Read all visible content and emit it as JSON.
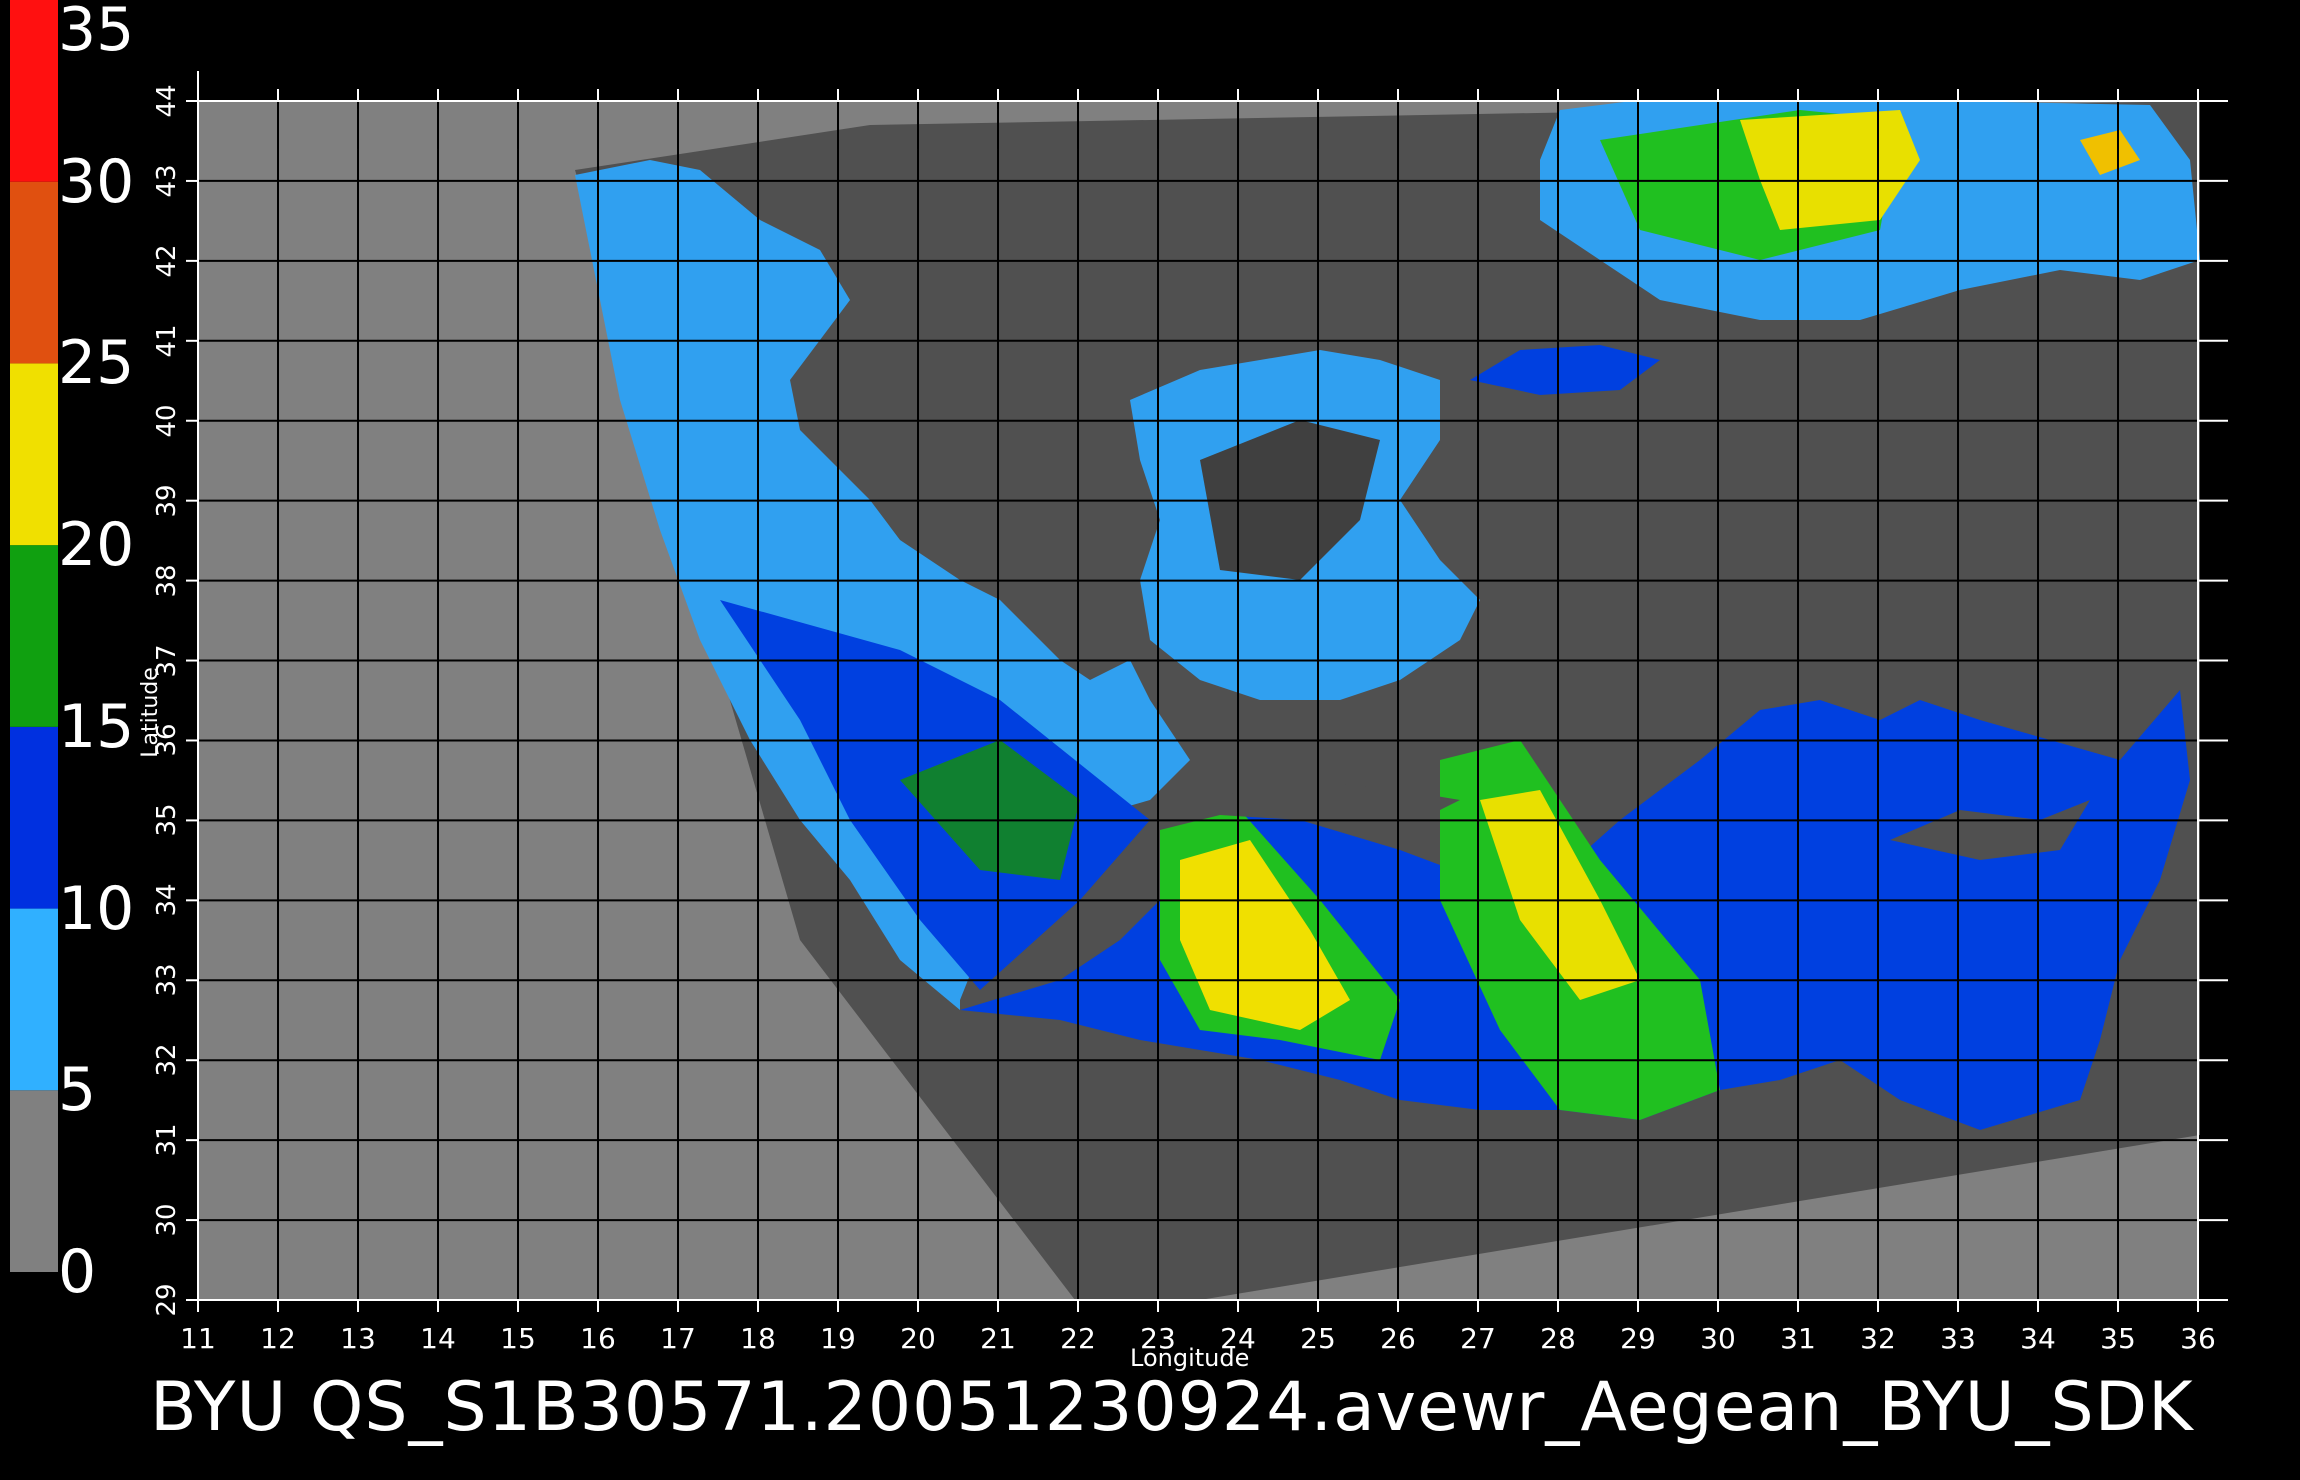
{
  "map": {
    "colorbar": {
      "ticks": [
        "0",
        "5",
        "10",
        "15",
        "20",
        "25",
        "30",
        "35"
      ],
      "segments": [
        {
          "from": 0,
          "to": 5,
          "color": "#808080"
        },
        {
          "from": 5,
          "to": 10,
          "color": "#30b0ff"
        },
        {
          "from": 10,
          "to": 15,
          "color": "#0030e0"
        },
        {
          "from": 15,
          "to": 20,
          "color": "#10a010"
        },
        {
          "from": 20,
          "to": 25,
          "color": "#f0e000"
        },
        {
          "from": 25,
          "to": 30,
          "color": "#e05010"
        },
        {
          "from": 30,
          "to": 35,
          "color": "#ff1010"
        }
      ],
      "range": [
        0,
        35
      ]
    },
    "longitude_ticks": [
      "11",
      "12",
      "13",
      "14",
      "15",
      "16",
      "17",
      "18",
      "19",
      "20",
      "21",
      "22",
      "23",
      "24",
      "25",
      "26",
      "27",
      "28",
      "29",
      "30",
      "31",
      "32",
      "33",
      "34",
      "35",
      "36"
    ],
    "latitude_ticks": [
      "29",
      "30",
      "31",
      "32",
      "33",
      "34",
      "35",
      "36",
      "37",
      "38",
      "39",
      "40",
      "41",
      "42",
      "43",
      "44"
    ],
    "xlabel": "Longitude",
    "ylabel": "Latitude",
    "lon_range": [
      11,
      36
    ],
    "lat_range": [
      29,
      44
    ],
    "footer": "BYU  QS_S1B30571.20051230924.avewr_Aegean_BYU_SDK",
    "colors": {
      "background": "#000000",
      "out_of_swath": "#808080",
      "swath_no_data": "#505050",
      "grid": "#000000"
    }
  }
}
